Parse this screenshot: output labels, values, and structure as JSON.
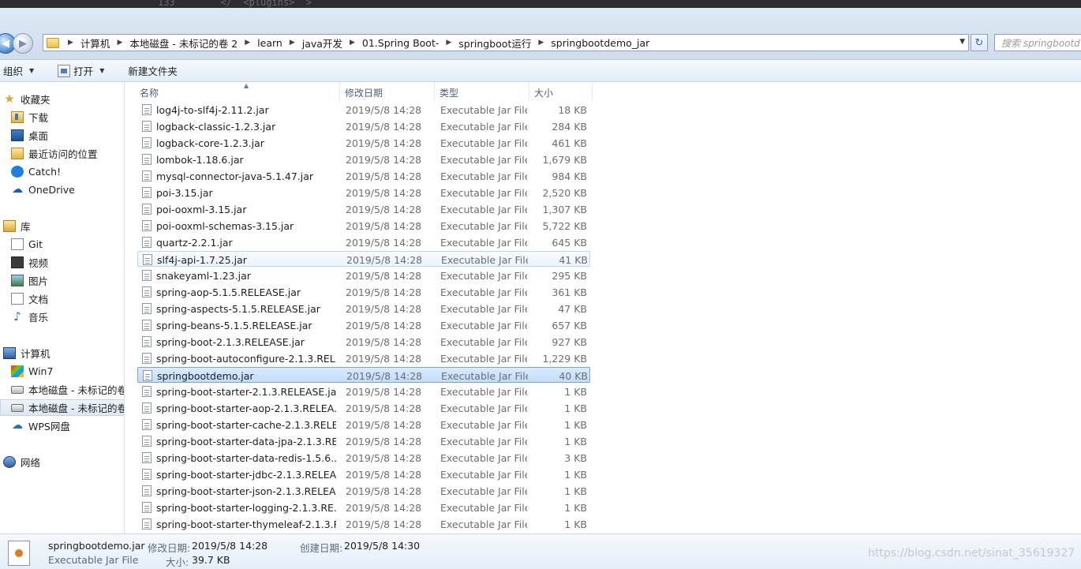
{
  "address_bar": {
    "crumbs": [
      "计算机",
      "本地磁盘 - 未标记的卷 2",
      "learn",
      "java开发",
      "01.Spring Boot-",
      "springboot运行",
      "springbootdemo_jar"
    ],
    "search_placeholder": "搜索 springbootd"
  },
  "toolbar": {
    "organize": "组织",
    "open": "打开",
    "new_folder": "新建文件夹"
  },
  "sidebar": {
    "favorites": "收藏夹",
    "downloads": "下载",
    "desktop": "桌面",
    "recent": "最近访问的位置",
    "catch": "Catch!",
    "onedrive": "OneDrive",
    "libraries": "库",
    "git": "Git",
    "videos": "视频",
    "pictures": "图片",
    "documents": "文档",
    "music": "音乐",
    "computer": "计算机",
    "win7": "Win7",
    "disk1": "本地磁盘 - 未标记的卷",
    "disk2": "本地磁盘 - 未标记的卷",
    "wps": "WPS网盘",
    "network": "网络"
  },
  "columns": {
    "name": "名称",
    "date": "修改日期",
    "type": "类型",
    "size": "大小"
  },
  "files": [
    {
      "name": "log4j-to-slf4j-2.11.2.jar",
      "date": "2019/5/8 14:28",
      "type": "Executable Jar File",
      "size": "18 KB"
    },
    {
      "name": "logback-classic-1.2.3.jar",
      "date": "2019/5/8 14:28",
      "type": "Executable Jar File",
      "size": "284 KB"
    },
    {
      "name": "logback-core-1.2.3.jar",
      "date": "2019/5/8 14:28",
      "type": "Executable Jar File",
      "size": "461 KB"
    },
    {
      "name": "lombok-1.18.6.jar",
      "date": "2019/5/8 14:28",
      "type": "Executable Jar File",
      "size": "1,679 KB"
    },
    {
      "name": "mysql-connector-java-5.1.47.jar",
      "date": "2019/5/8 14:28",
      "type": "Executable Jar File",
      "size": "984 KB"
    },
    {
      "name": "poi-3.15.jar",
      "date": "2019/5/8 14:28",
      "type": "Executable Jar File",
      "size": "2,520 KB"
    },
    {
      "name": "poi-ooxml-3.15.jar",
      "date": "2019/5/8 14:28",
      "type": "Executable Jar File",
      "size": "1,307 KB"
    },
    {
      "name": "poi-ooxml-schemas-3.15.jar",
      "date": "2019/5/8 14:28",
      "type": "Executable Jar File",
      "size": "5,722 KB"
    },
    {
      "name": "quartz-2.2.1.jar",
      "date": "2019/5/8 14:28",
      "type": "Executable Jar File",
      "size": "645 KB"
    },
    {
      "name": "slf4j-api-1.7.25.jar",
      "date": "2019/5/8 14:28",
      "type": "Executable Jar File",
      "size": "41 KB"
    },
    {
      "name": "snakeyaml-1.23.jar",
      "date": "2019/5/8 14:28",
      "type": "Executable Jar File",
      "size": "295 KB"
    },
    {
      "name": "spring-aop-5.1.5.RELEASE.jar",
      "date": "2019/5/8 14:28",
      "type": "Executable Jar File",
      "size": "361 KB"
    },
    {
      "name": "spring-aspects-5.1.5.RELEASE.jar",
      "date": "2019/5/8 14:28",
      "type": "Executable Jar File",
      "size": "47 KB"
    },
    {
      "name": "spring-beans-5.1.5.RELEASE.jar",
      "date": "2019/5/8 14:28",
      "type": "Executable Jar File",
      "size": "657 KB"
    },
    {
      "name": "spring-boot-2.1.3.RELEASE.jar",
      "date": "2019/5/8 14:28",
      "type": "Executable Jar File",
      "size": "927 KB"
    },
    {
      "name": "spring-boot-autoconfigure-2.1.3.REL...",
      "date": "2019/5/8 14:28",
      "type": "Executable Jar File",
      "size": "1,229 KB"
    },
    {
      "name": "springbootdemo.jar",
      "date": "2019/5/8 14:28",
      "type": "Executable Jar File",
      "size": "40 KB"
    },
    {
      "name": "spring-boot-starter-2.1.3.RELEASE.jar",
      "date": "2019/5/8 14:28",
      "type": "Executable Jar File",
      "size": "1 KB"
    },
    {
      "name": "spring-boot-starter-aop-2.1.3.RELEA...",
      "date": "2019/5/8 14:28",
      "type": "Executable Jar File",
      "size": "1 KB"
    },
    {
      "name": "spring-boot-starter-cache-2.1.3.RELE...",
      "date": "2019/5/8 14:28",
      "type": "Executable Jar File",
      "size": "1 KB"
    },
    {
      "name": "spring-boot-starter-data-jpa-2.1.3.RE...",
      "date": "2019/5/8 14:28",
      "type": "Executable Jar File",
      "size": "1 KB"
    },
    {
      "name": "spring-boot-starter-data-redis-1.5.6....",
      "date": "2019/5/8 14:28",
      "type": "Executable Jar File",
      "size": "3 KB"
    },
    {
      "name": "spring-boot-starter-jdbc-2.1.3.RELEA...",
      "date": "2019/5/8 14:28",
      "type": "Executable Jar File",
      "size": "1 KB"
    },
    {
      "name": "spring-boot-starter-json-2.1.3.RELEA...",
      "date": "2019/5/8 14:28",
      "type": "Executable Jar File",
      "size": "1 KB"
    },
    {
      "name": "spring-boot-starter-logging-2.1.3.RE...",
      "date": "2019/5/8 14:28",
      "type": "Executable Jar File",
      "size": "1 KB"
    },
    {
      "name": "spring-boot-starter-thymeleaf-2.1.3.R...",
      "date": "2019/5/8 14:28",
      "type": "Executable Jar File",
      "size": "1 KB"
    }
  ],
  "selected_index": 16,
  "hover_index": 9,
  "details": {
    "filename": "springbootdemo.jar",
    "modified_label": "修改日期:",
    "modified_value": "2019/5/8 14:28",
    "created_label": "创建日期:",
    "created_value": "2019/5/8 14:30",
    "type": "Executable Jar File",
    "size_label": "大小:",
    "size_value": "39.7 KB"
  },
  "watermark": "https://blog.csdn.net/sinat_35619327"
}
